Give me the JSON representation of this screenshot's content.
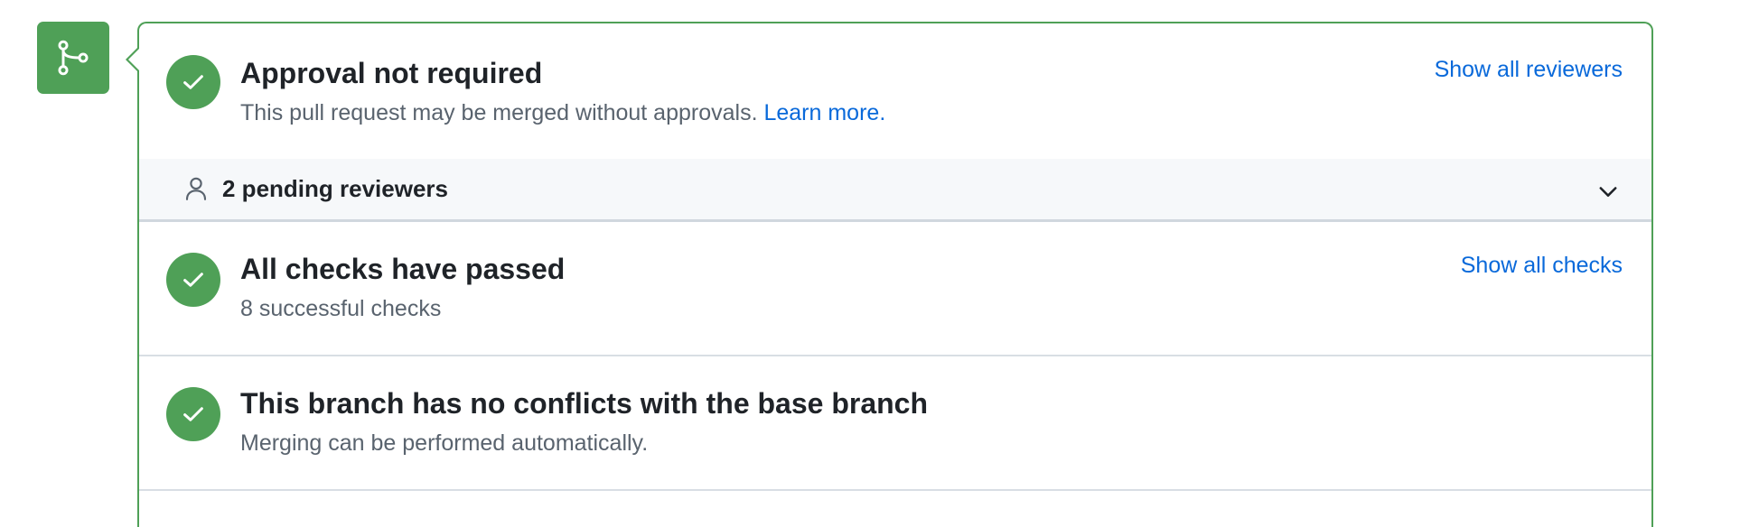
{
  "colors": {
    "success": "#4fa057",
    "link": "#0969da",
    "muted_text": "#59636e",
    "pending_bg": "#f6f8fa"
  },
  "merge_badge": {
    "icon": "git-merge-icon"
  },
  "approval": {
    "title": "Approval not required",
    "description": "This pull request may be merged without approvals.",
    "learn_more": "Learn more.",
    "show_all": "Show all reviewers",
    "icon": "check-icon"
  },
  "pending": {
    "label": "2 pending reviewers",
    "icon": "person-icon",
    "toggle_icon": "chevron-down-icon"
  },
  "checks": {
    "title": "All checks have passed",
    "description": "8 successful checks",
    "show_all": "Show all checks",
    "icon": "check-icon"
  },
  "conflicts": {
    "title": "This branch has no conflicts with the base branch",
    "description": "Merging can be performed automatically.",
    "icon": "check-icon"
  }
}
